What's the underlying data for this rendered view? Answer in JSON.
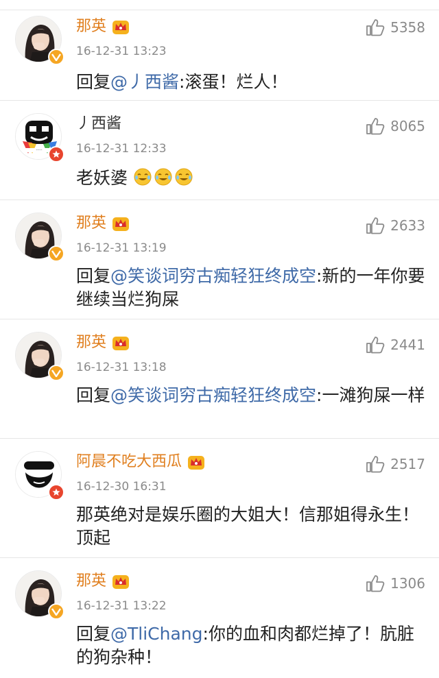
{
  "comments": [
    {
      "user": "那英",
      "time": "16-12-31 13:23",
      "likes": "5358",
      "prefix": "回复",
      "mention": "@丿西酱",
      "body": ":滚蛋！烂人！"
    },
    {
      "user": "丿西酱",
      "time": "16-12-31 12:33",
      "likes": "8065",
      "body": "老妖婆"
    },
    {
      "user": "那英",
      "time": "16-12-31 13:19",
      "likes": "2633",
      "prefix": "回复",
      "mention": "@笑谈词穷古痴轻狂终成空",
      "body": ":新的一年你要继续当烂狗屎"
    },
    {
      "user": "那英",
      "time": "16-12-31 13:18",
      "likes": "2441",
      "prefix": "回复",
      "mention": "@笑谈词穷古痴轻狂终成空",
      "body": ":一滩狗屎一样"
    },
    {
      "user": "阿晨不吃大西瓜",
      "time": "16-12-30 16:31",
      "likes": "2517",
      "body": "那英绝对是娱乐圈的大姐大！信那姐得永生！顶起"
    },
    {
      "user": "那英",
      "time": "16-12-31 13:22",
      "likes": "1306",
      "prefix": "回复",
      "mention": "@TliChang",
      "body": ":你的血和肉都烂掉了！肮脏的狗杂种！"
    }
  ],
  "colors": {
    "username_vip": "#e07f1f",
    "mention": "#3f6aa8",
    "meta": "#8a8a8a"
  },
  "icons": {
    "crown": "vip-crown-icon",
    "like": "thumbs-up-icon",
    "verified": "verified-v-icon",
    "star": "star-badge-icon",
    "emoji": "crying-laughing-emoji"
  }
}
